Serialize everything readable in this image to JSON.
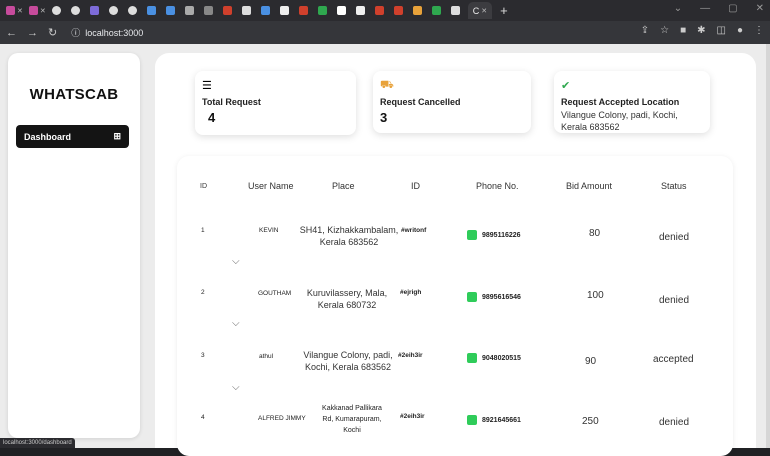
{
  "browser": {
    "url": "localhost:3000",
    "active_tab_label": "C",
    "new_tab": "+",
    "status_url": "localhost:3000/dashboard"
  },
  "sidebar": {
    "brand": "WHATSCAB",
    "nav": [
      {
        "label": "Dashboard",
        "icon": "grid-icon"
      }
    ]
  },
  "stats": [
    {
      "label": "Total Request",
      "value": "4",
      "icon": "server-icon"
    },
    {
      "label": "Request Cancelled",
      "value": "3",
      "icon": "car-icon"
    },
    {
      "label": "Request  Accepted Location",
      "value": "Vilangue Colony, padi, Kochi, Kerala 683562",
      "icon": "check-circle-icon"
    }
  ],
  "table": {
    "headers": [
      "ID",
      "User Name",
      "Place",
      "ID",
      "Phone No.",
      "Bid Amount",
      "Status"
    ],
    "rows": [
      {
        "id": "1",
        "user": "KEVIN",
        "place": "SH41, Kizhakkambalam, Kerala 683562",
        "ref": "#writonf",
        "phone": "9895116226",
        "bid": "80",
        "status": "denied"
      },
      {
        "id": "2",
        "user": "GOUTHAM",
        "place": "Kuruvilassery, Mala, Kerala 680732",
        "ref": "#ejrigh",
        "phone": "9895616546",
        "bid": "100",
        "status": "denied"
      },
      {
        "id": "3",
        "user": "athul",
        "place": "Vilangue Colony, padi, Kochi, Kerala 683562",
        "ref": "#2eih3ir",
        "phone": "9048020515",
        "bid": "90",
        "status": "accepted"
      },
      {
        "id": "4",
        "user": "ALFRED JIMMY",
        "place": "Kakkanad Pallikara Rd, Kumarapuram, Kochi",
        "ref": "#2eih3ir",
        "phone": "8921645661",
        "bid": "250",
        "status": "denied"
      }
    ]
  },
  "colors": {
    "accent": "#141414",
    "whatsapp": "#2fcc5a"
  }
}
